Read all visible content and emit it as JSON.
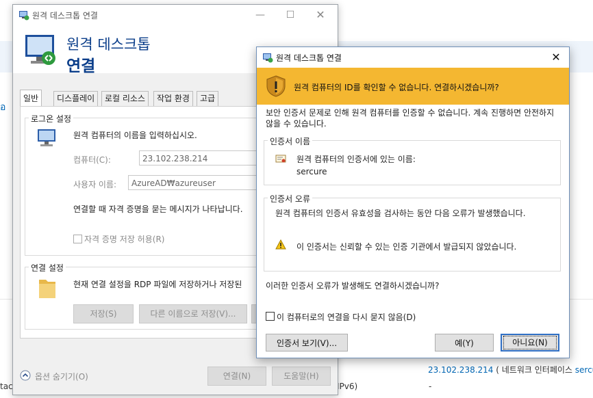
{
  "background": {
    "left_letter": "อ",
    "bottom_left_text": "tac",
    "ipv6_text": "IPv6)",
    "ip_link": "23.102.238.214",
    "ip_suffix": "( 네트워크 인터페이스 ",
    "ip_link2": "sercure",
    "dash": "-"
  },
  "main_window": {
    "title": "원격 데스크톱 연결",
    "header_line1": "원격 데스크톱",
    "header_line2": "연결",
    "tabs": [
      "일반",
      "디스플레이",
      "로컬 리소스",
      "작업 환경",
      "고급"
    ],
    "login_group": {
      "label": "로그온 설정",
      "instruction": "원격 컴퓨터의 이름을 입력하십시오.",
      "computer_label": "컴퓨터(C):",
      "computer_value": "23.102.238.214",
      "user_label": "사용자 이름:",
      "user_value": "AzureAD₩azureuser",
      "prompt_text": "연결할 때 자격 증명을 묻는 메시지가 나타납니다.",
      "save_credentials": "자격 증명 저장 허용(R)"
    },
    "connection_group": {
      "label": "연결 설정",
      "text": "현재 연결 설정을 RDP 파일에 저장하거나 저장된",
      "save_button": "저장(S)",
      "save_as_button": "다른 이름으로 저장(V)..."
    },
    "hide_options": "옵션 숨기기(O)",
    "connect_button": "연결(N)",
    "help_button": "도움말(H)"
  },
  "dialog": {
    "title": "원격 데스크톱 연결",
    "warning": "원격 컴퓨터의 ID를 확인할 수 없습니다. 연결하시겠습니까?",
    "description": "보안 인증서 문제로 인해 원격 컴퓨터를 인증할 수 없습니다. 계속 진행하면 안전하지 않을 수 있습니다.",
    "cert_name_group": {
      "label": "인증서 이름",
      "text": "원격 컴퓨터의 인증서에 있는 이름:",
      "value": "sercure"
    },
    "cert_error_group": {
      "label": "인증서 오류",
      "text": "원격 컴퓨터의 인증서 유효성을 검사하는 동안 다음 오류가 발생했습니다.",
      "error_item": "이 인증서는 신뢰할 수 있는 인증 기관에서 발급되지 않았습니다."
    },
    "question": "이러한 인증서 오류가 발생해도 연결하시겠습니까?",
    "dont_ask": "이 컴퓨터로의 연결을 다시 묻지 않음(D)",
    "view_cert_button": "인증서 보기(V)...",
    "yes_button": "예(Y)",
    "no_button": "아니요(N)"
  },
  "colors": {
    "header_blue": "#0b3e8a",
    "warning_band": "#f4b731",
    "link": "#0066b4"
  },
  "icons": [
    "rdp-app-icon",
    "monitor-connect-icon",
    "computer-icon",
    "folder-icon",
    "shield-warning-icon",
    "certificate-icon",
    "warning-triangle-icon",
    "chevron-up-icon",
    "close-icon",
    "minimize-icon",
    "maximize-icon"
  ]
}
